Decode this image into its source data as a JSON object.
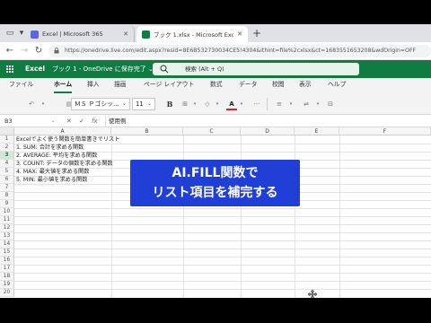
{
  "browser": {
    "tabs": [
      {
        "title": "Excel | Microsoft 365",
        "active": false
      },
      {
        "title": "ブック 1.xlsx - Microsoft Excel Onl",
        "active": true
      }
    ],
    "new_tab": "+",
    "address": "https://onedrive.live.com/edit.aspx?resid=8E6B532730034CE5!4304&ithint=file%2cxlsx&ct=1683551653208&wdOrigin=OFF"
  },
  "excel": {
    "app_name": "Excel",
    "doc_name": "ブック 1 - OneDrive に保存完了 ⌄",
    "search_placeholder": "検索 (Alt + Q)"
  },
  "menu": {
    "items": [
      "ファイル",
      "ホーム",
      "挿入",
      "描画",
      "ページ レイアウト",
      "数式",
      "データ",
      "校閲",
      "表示",
      "ヘルプ"
    ],
    "active": "ホーム"
  },
  "ribbon": {
    "font_name": "ＭＳ Ｐゴシッ...",
    "font_size": "11",
    "bold": "B",
    "font_color": "A"
  },
  "formula_bar": {
    "cell_ref": "B3",
    "cancel": "✕",
    "enter": "✓",
    "fx": "fx",
    "value": "使用例"
  },
  "grid": {
    "columns": [
      "A",
      "B",
      "C",
      "D",
      "E",
      "F"
    ],
    "rows": [
      "1",
      "2",
      "3",
      "4",
      "5",
      "6",
      "7",
      "8",
      "9",
      "10",
      "11",
      "12",
      "13",
      "14",
      "15",
      "16",
      "17",
      "18",
      "19",
      "20"
    ],
    "selected_row": "3",
    "cells": [
      "Excelでよく使う関数を簡単書きでリスト",
      "1. SUM: 合計を求める関数",
      "2. AVERAGE: 平均を求める関数",
      "3. COUNT: データの個数を求める関数",
      "4. MAX: 最大値を求める関数",
      "5. MIN: 最小値を求める関数"
    ]
  },
  "overlay": {
    "line1": "AI.FILL関数で",
    "line2": "リスト項目を補完する"
  },
  "colors": {
    "excel_green": "#107c41",
    "overlay_blue": "#1f3fd6"
  }
}
